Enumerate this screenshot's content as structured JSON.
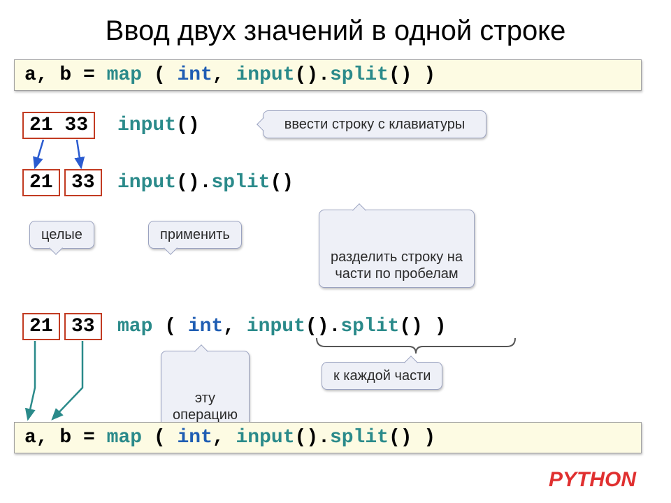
{
  "title": "Ввод двух значений в одной строке",
  "code_line_top": {
    "t1": "a, b = ",
    "t2": "map",
    "t3": " ( ",
    "t4": "int",
    "t5": ", ",
    "t6": "input",
    "t7": "().",
    "t8": "split",
    "t9": "() )"
  },
  "row1": {
    "num_pair": "21 33",
    "code_a": "input",
    "code_b": "()"
  },
  "callout_keyboard": "ввести строку с клавиатуры",
  "row2": {
    "num_a": "21",
    "num_b": "33",
    "code_a": "input",
    "code_b": "().",
    "code_c": "split",
    "code_d": "()"
  },
  "callout_int": "целые",
  "callout_apply": "применить",
  "callout_split": "разделить строку на\nчасти по пробелам",
  "row3": {
    "num_a": "21",
    "num_b": "33",
    "code_a": "map",
    "code_b": " ( ",
    "code_c": "int",
    "code_d": ", ",
    "code_e": "input",
    "code_f": "().",
    "code_g": "split",
    "code_h": "() )"
  },
  "callout_thisop": "эту\nоперацию",
  "callout_each": "к каждой части",
  "code_line_bottom": {
    "t1": "a, b = ",
    "t2": "map",
    "t3": " ( ",
    "t4": "int",
    "t5": ", ",
    "t6": "input",
    "t7": "().",
    "t8": "split",
    "t9": "() )"
  },
  "python": "PYTHON"
}
